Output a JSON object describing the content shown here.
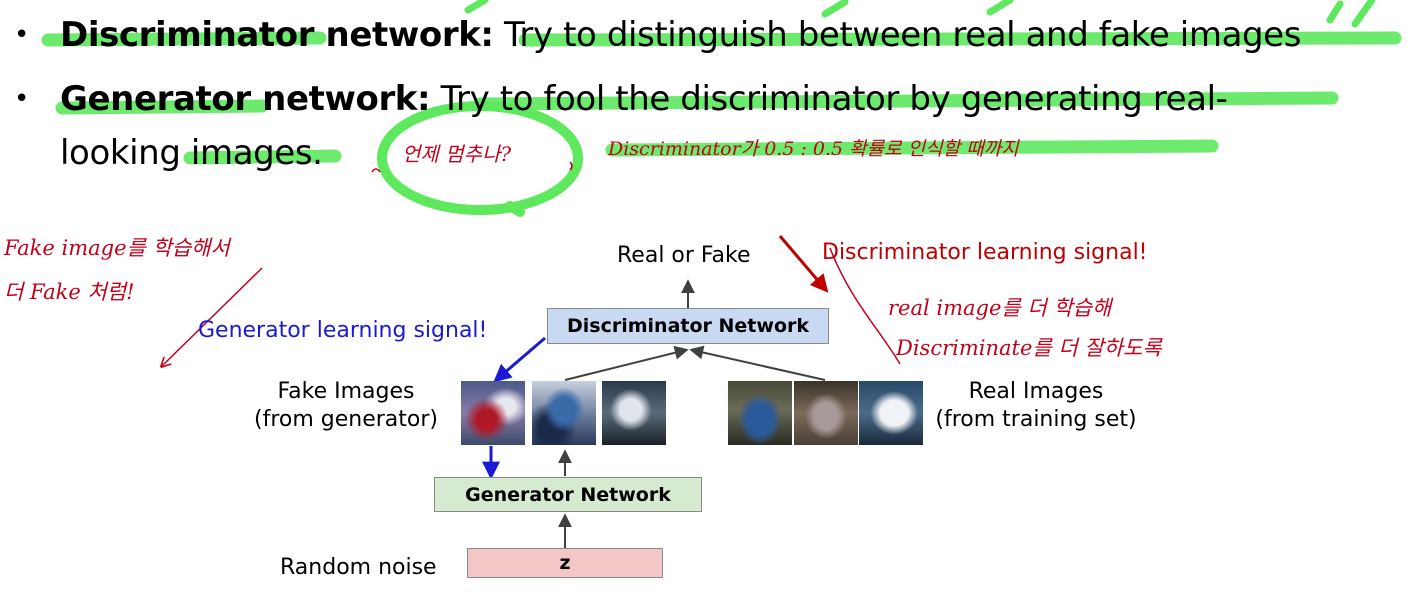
{
  "bullets": [
    {
      "term": "Discriminator network:",
      "text": " Try to distinguish between real and fake images"
    },
    {
      "term": "Generator network:",
      "text": " Try to fool the discriminator by generating real-",
      "continuation": "looking images."
    }
  ],
  "diagram": {
    "output_label": "Real or Fake",
    "discriminator_box": "Discriminator Network",
    "generator_box": "Generator Network",
    "noise_box": "z",
    "noise_label": "Random noise",
    "fake_images_label_1": "Fake Images",
    "fake_images_label_2": "(from generator)",
    "real_images_label_1": "Real Images",
    "real_images_label_2": "(from training set)",
    "generator_signal": "Generator learning signal!",
    "discriminator_signal": "Discriminator learning signal!"
  },
  "colors": {
    "discriminator_box_fill": "#c9d9f2",
    "generator_box_fill": "#d6ead0",
    "noise_box_fill": "#f4c7c7",
    "generator_signal": "#1a1ad6",
    "discriminator_signal": "#c00000",
    "highlighter": "#5ee85e",
    "handwriting": "#c4001a"
  },
  "annotations": {
    "circled_note": "언제 멈추나?",
    "top_note": "Discriminator가 0.5 : 0.5 확률로 인식할 때까지",
    "left_note_1": "Fake image를 학습해서",
    "left_note_2": "더 Fake 처럼!",
    "right_note_1": "real image를 더 학습해",
    "right_note_2": "Discriminate를 더 잘하도록"
  }
}
